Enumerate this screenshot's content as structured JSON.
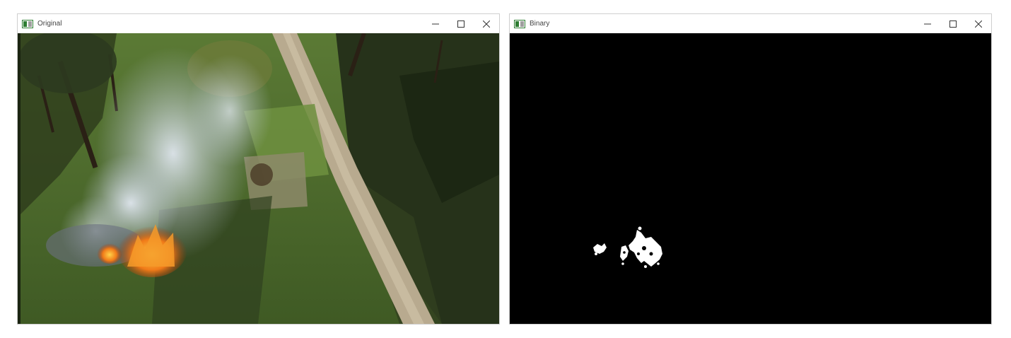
{
  "windows": {
    "original": {
      "title": "Original",
      "icon": "opencv-window-icon",
      "controls": [
        "minimize-icon",
        "maximize-icon",
        "close-icon"
      ]
    },
    "binary": {
      "title": "Binary",
      "icon": "opencv-window-icon",
      "controls": [
        "minimize-icon",
        "maximize-icon",
        "close-icon"
      ],
      "background": "#000000",
      "foreground": "#ffffff"
    }
  },
  "colors": {
    "grass": "#4f6b2f",
    "shadow": "#1f2a16",
    "path": "#b8aa8f",
    "smoke": "#c9d2dc",
    "fire": "#f07a18"
  }
}
